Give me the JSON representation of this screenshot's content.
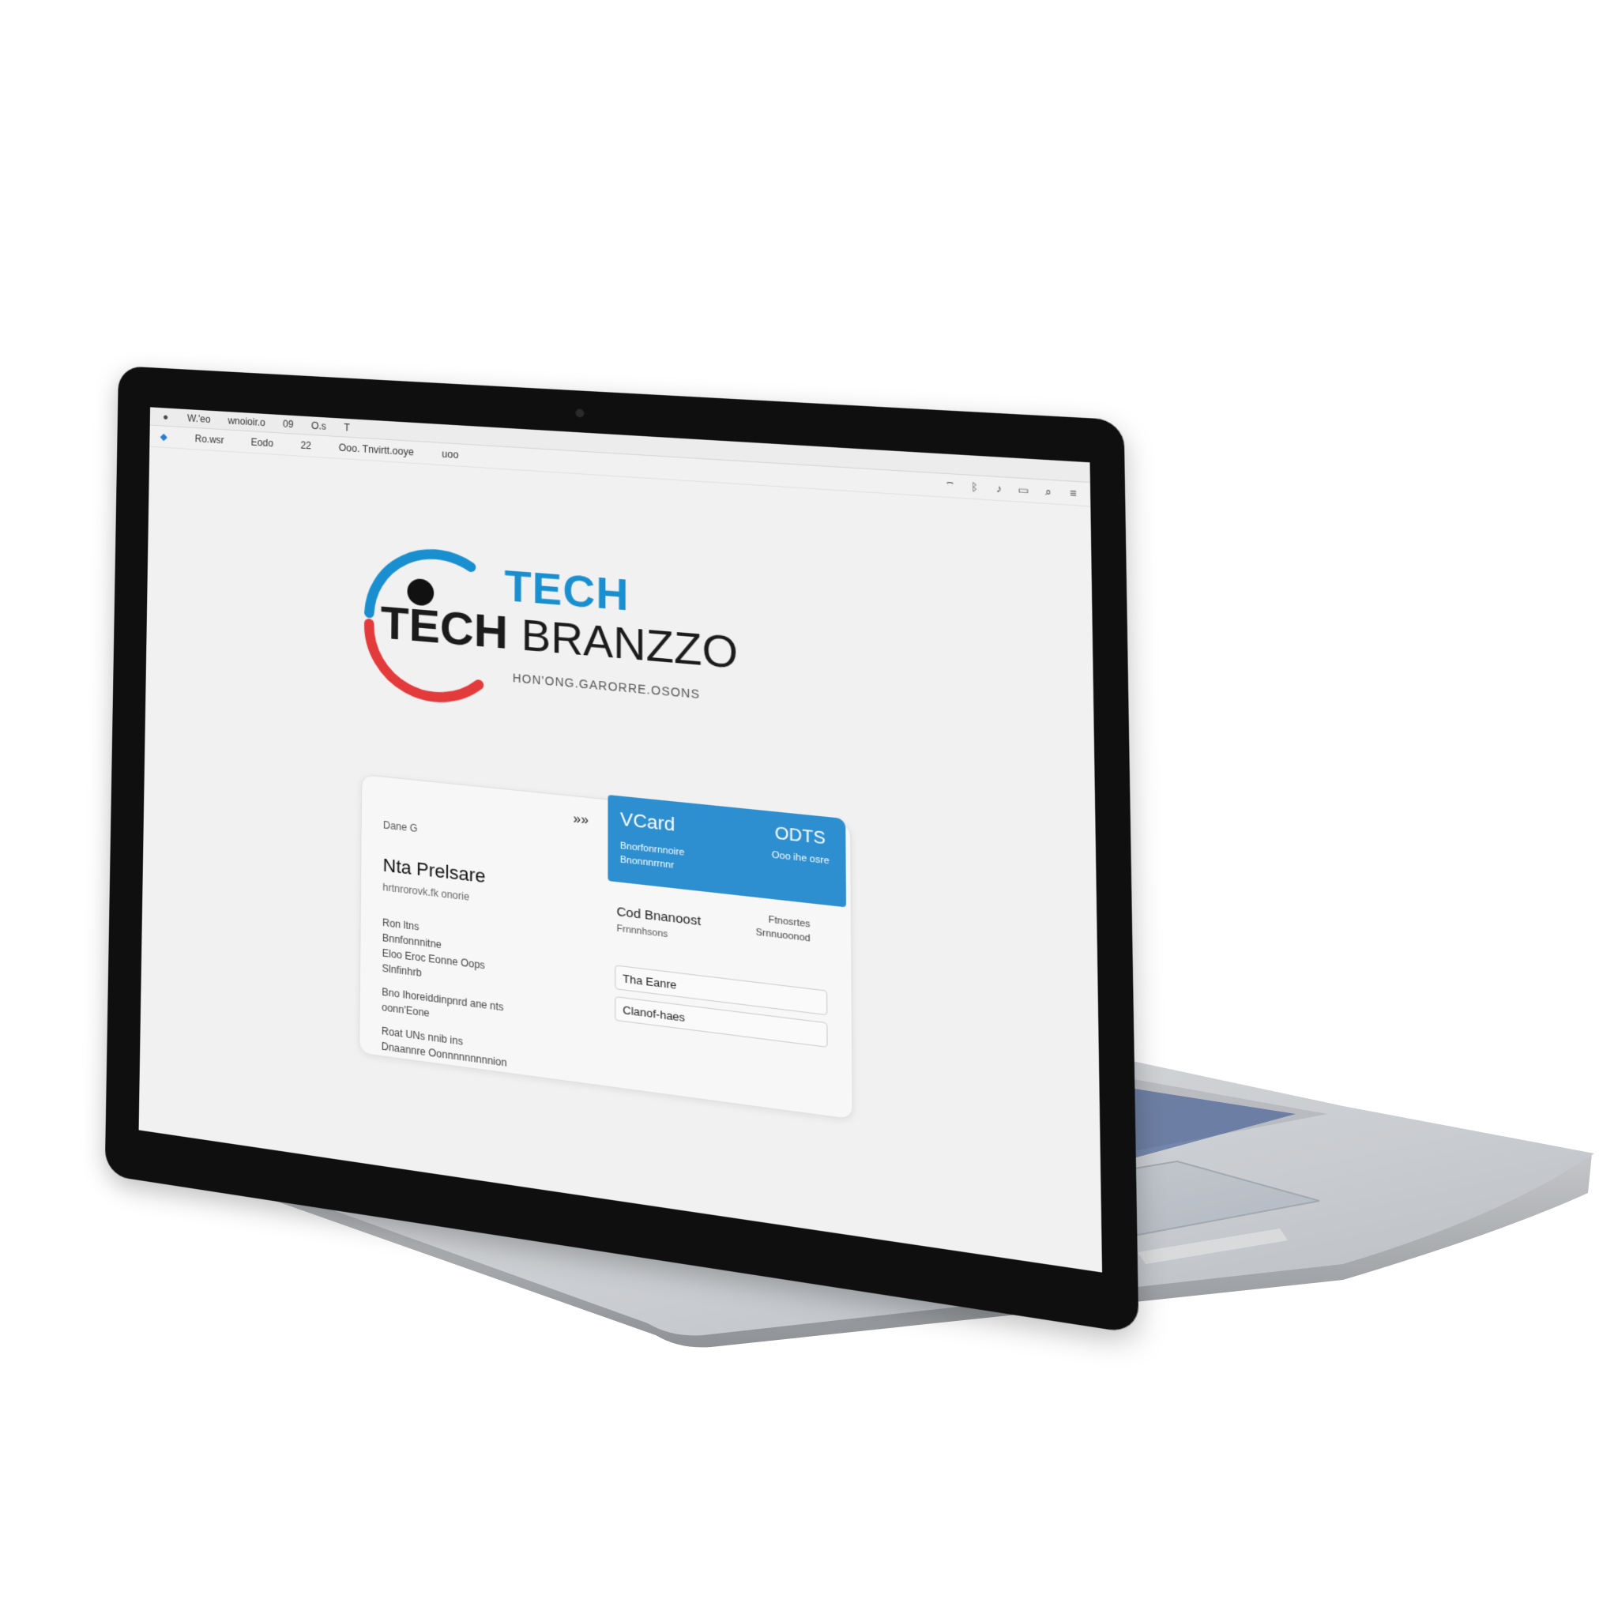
{
  "menubar": {
    "items": [
      "W.'eo",
      "wnoioir.o",
      "09",
      "O.s",
      "T"
    ]
  },
  "toolbar": {
    "items": [
      "Ro.wsr",
      "Eodo",
      "22",
      "Ooo. Tnvirtt.ooye",
      "uoo"
    ]
  },
  "logo": {
    "tech": "TECH",
    "main_left": "TECH",
    "main_right": "BRANZZO",
    "tagline": "HON'ONG.GARORRE.OSONS"
  },
  "panel": {
    "arrows": "»»",
    "left": {
      "small": "Dane G",
      "title": "Nta Prelsare",
      "subtitle": "hrtnrorovk.fk onorie",
      "lines": [
        "Ron ltns",
        "Bnnfonnnitne",
        "Eloo Eroc Eonne Oops",
        "Slnfinhrb",
        "Bno Ihoreiddinpnrd ane nts",
        "oonn'Eone",
        "Roat UNs nnib ins",
        "Dnaannre Oonnnnnnnnnion"
      ]
    },
    "vcard": {
      "title": "VCard",
      "right": "ODTS",
      "sub1": "Bnorfonrnnoire",
      "sub2": "Bnonnnrrnnr",
      "sub3": "Ooo ihe osre"
    },
    "right": {
      "meta1": "Ftnosrtes",
      "meta2": "Srnnuoonod",
      "heading": "Cod Bnanoost",
      "sub": "Frnnnhsons",
      "field1": "Tha Eanre",
      "field2": "Clanof-haes"
    }
  }
}
